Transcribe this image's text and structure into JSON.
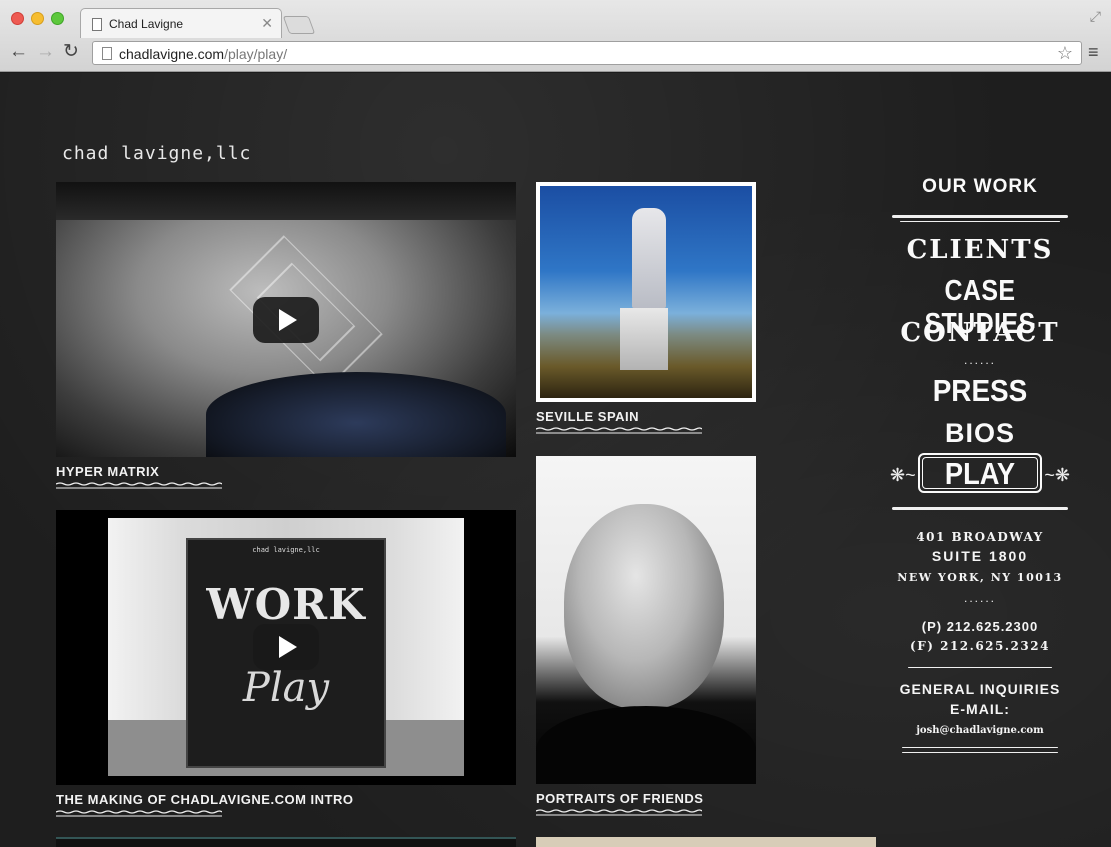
{
  "browser": {
    "tab_title": "Chad Lavigne",
    "url_domain": "chadlavigne.com",
    "url_path": "/play/play/"
  },
  "site": {
    "logo": "chad lavigne,llc"
  },
  "tiles": {
    "video1_label": "HYPER MATRIX",
    "video2_label": "THE MAKING OF CHADLAVIGNE.COM INTRO",
    "photo1_label": "SEVILLE SPAIN",
    "photo2_label": "PORTRAITS OF FRIENDS",
    "board_small": "chad lavigne,llc",
    "board_work": "WORK",
    "board_play": "Play"
  },
  "sidebar": {
    "our_work": "OUR WORK",
    "clients": "CLIENTS",
    "case_studies": "CASE STUDIES",
    "contact": "CONTACT",
    "dots": "......",
    "press": "PRESS",
    "bios": "BIOS",
    "play": "PLAY",
    "address_line1": "401 BROADWAY",
    "address_line2": "SUITE 1800",
    "address_line3": "NEW YORK, NY 10013",
    "phone": "(P) 212.625.2300",
    "fax": "(F) 212.625.2324",
    "inquiries_label": "GENERAL INQUIRIES",
    "email_label": "E-MAIL:",
    "email": "josh@chadlavigne.com"
  }
}
